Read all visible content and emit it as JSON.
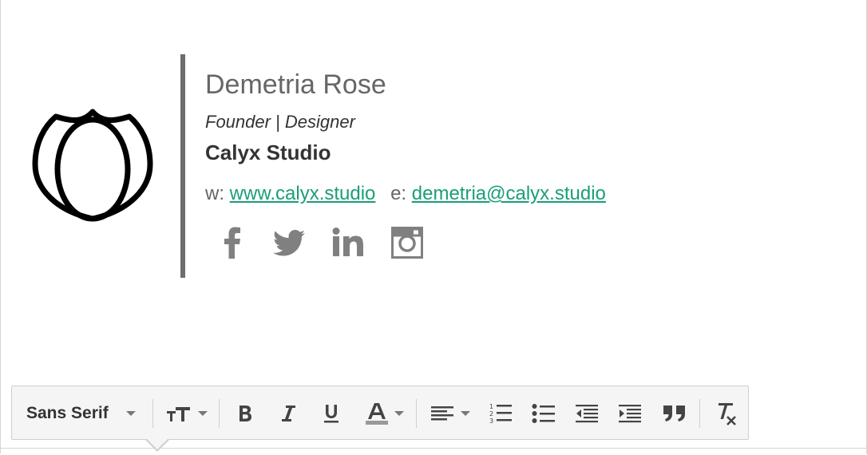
{
  "signature": {
    "name": "Demetria Rose",
    "role": "Founder | Designer",
    "company": "Calyx Studio",
    "website_prefix": "w:",
    "website": "www.calyx.studio",
    "email_prefix": "e:",
    "email": "demetria@calyx.studio",
    "link_color": "#1a9e7a",
    "social_icons": [
      "facebook-icon",
      "twitter-icon",
      "linkedin-icon",
      "instagram-icon"
    ]
  },
  "toolbar": {
    "font_family": "Sans Serif",
    "buttons": [
      "font-size",
      "bold",
      "italic",
      "underline",
      "text-color",
      "align",
      "numbered-list",
      "bulleted-list",
      "indent-less",
      "indent-more",
      "quote",
      "remove-formatting"
    ]
  }
}
